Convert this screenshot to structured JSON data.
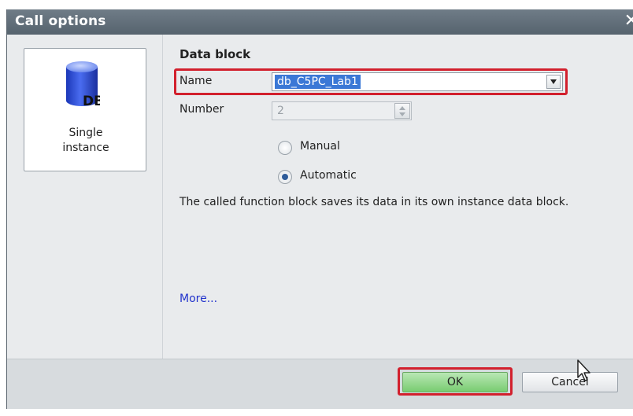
{
  "dialog": {
    "title": "Call options"
  },
  "left_panel": {
    "card": {
      "icon_text": "DB",
      "label_line1": "Single",
      "label_line2": "instance"
    }
  },
  "data_block": {
    "section_title": "Data block",
    "name_label": "Name",
    "name_value": "db_C5PC_Lab1",
    "number_label": "Number",
    "number_value": "2",
    "radio_manual_label": "Manual",
    "radio_automatic_label": "Automatic",
    "selected_mode": "Automatic",
    "description": "The called function block saves its data in its own instance data block.",
    "more_link": "More..."
  },
  "buttons": {
    "ok_label": "OK",
    "cancel_label": "Cancel"
  },
  "colors": {
    "highlight": "#d2202d",
    "ok_green": "#79cc71",
    "selection_blue": "#3b78d6",
    "link_blue": "#2233cc"
  },
  "icons": {
    "close": "close-icon",
    "db": "db-cylinder-icon",
    "combo": "chevron-down-icon",
    "cursor": "mouse-cursor-icon"
  }
}
